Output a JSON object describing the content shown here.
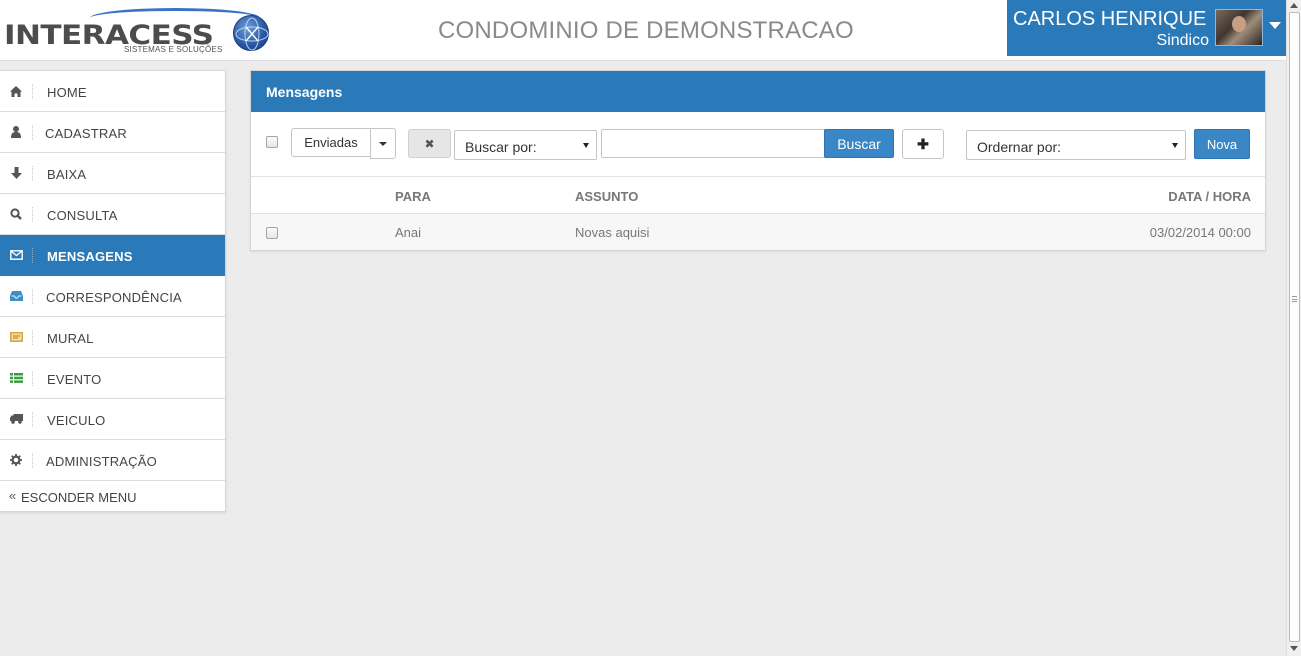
{
  "header": {
    "logo_text": "INTERACESS",
    "logo_subtitle": "SISTEMAS E SOLUÇÕES",
    "site_title": "CONDOMINIO DE DEMONSTRACAO",
    "user_name": "CARLOS HENRIQUE",
    "user_role": "Sindico"
  },
  "sidebar": {
    "items": [
      {
        "label": "HOME",
        "icon": "home-icon",
        "active": false
      },
      {
        "label": "CADASTRAR",
        "icon": "user-icon",
        "active": false
      },
      {
        "label": "BAIXA",
        "icon": "arrow-down-icon",
        "active": false
      },
      {
        "label": "CONSULTA",
        "icon": "search-icon",
        "active": false
      },
      {
        "label": "MENSAGENS",
        "icon": "envelope-icon",
        "active": true
      },
      {
        "label": "CORRESPONDÊNCIA",
        "icon": "inbox-icon",
        "active": false
      },
      {
        "label": "MURAL",
        "icon": "board-icon",
        "active": false
      },
      {
        "label": "EVENTO",
        "icon": "list-icon",
        "active": false
      },
      {
        "label": "VEICULO",
        "icon": "truck-icon",
        "active": false
      },
      {
        "label": "ADMINISTRAÇÃO",
        "icon": "gear-icon",
        "active": false
      }
    ],
    "hide_label": "ESCONDER MENU"
  },
  "panel": {
    "title": "Mensagens",
    "filter_selected": "Enviadas",
    "clear_symbol": "✖",
    "search_by_placeholder": "Buscar por:",
    "search_input_value": "",
    "search_button": "Buscar",
    "add_symbol": "✚",
    "order_by_placeholder": "Ordernar por:",
    "new_button": "Nova"
  },
  "table": {
    "columns": [
      "PARA",
      "ASSUNTO",
      "DATA / HORA"
    ],
    "rows": [
      {
        "para": "Anai",
        "assunto": "Novas aquisi",
        "data_hora": "03/02/2014 00:00"
      }
    ]
  },
  "colors": {
    "primary": "#2a7ab9",
    "button_primary": "#3a87c8",
    "background": "#ececec"
  }
}
